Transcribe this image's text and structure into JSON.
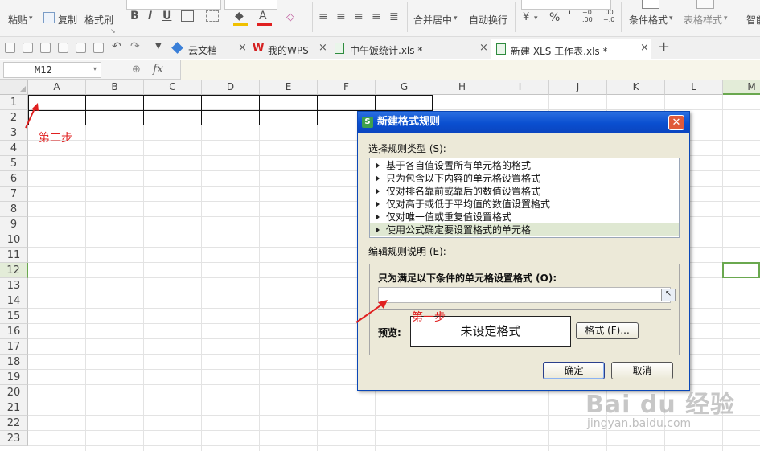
{
  "ribbon": {
    "paste_label": "粘贴",
    "copy_label": "复制",
    "format_painter_label": "格式刷",
    "bold": "B",
    "italic": "I",
    "underline": "U",
    "font_color": "A",
    "merge_center_label": "合并居中",
    "wrap_text_label": "自动换行",
    "percent": "%",
    "comma": "'",
    "decimal_increase": "+0\n.00",
    "decimal_decrease": ".00\n+.0",
    "conditional_format_label": "条件格式",
    "table_style_label": "表格样式",
    "smart_label": "智能"
  },
  "tabs": [
    {
      "label": "云文档",
      "icon": "cloud-icon",
      "active": false
    },
    {
      "label": "我的WPS",
      "icon": "wps-icon",
      "active": false
    },
    {
      "label": "中午饭统计.xls *",
      "icon": "sheet-icon",
      "active": false
    },
    {
      "label": "新建 XLS 工作表.xls *",
      "icon": "sheet-icon",
      "active": true
    }
  ],
  "tab_close": "×",
  "new_tab": "+",
  "formula_bar": {
    "cell_ref": "M12",
    "fx": "fx"
  },
  "columns": [
    "A",
    "B",
    "C",
    "D",
    "E",
    "F",
    "G",
    "H",
    "I",
    "J",
    "K",
    "L",
    "M"
  ],
  "rows": [
    "1",
    "2",
    "3",
    "4",
    "5",
    "6",
    "7",
    "8",
    "9",
    "10",
    "11",
    "12",
    "13",
    "14",
    "15",
    "16",
    "17",
    "18",
    "19",
    "20",
    "21",
    "22",
    "23"
  ],
  "selected_cell": "M12",
  "dialog": {
    "title": "新建格式规则",
    "close": "✕",
    "rule_type_label": "选择规则类型 (S):",
    "rule_types": [
      "基于各自值设置所有单元格的格式",
      "只为包含以下内容的单元格设置格式",
      "仅对排名靠前或靠后的数值设置格式",
      "仅对高于或低于平均值的数值设置格式",
      "仅对唯一值或重复值设置格式",
      "使用公式确定要设置格式的单元格"
    ],
    "selected_rule_index": 5,
    "edit_label": "编辑规则说明 (E):",
    "condition_label": "只为满足以下条件的单元格设置格式 (O):",
    "condition_value": "",
    "preview_label": "预览:",
    "preview_text": "未设定格式",
    "format_button": "格式 (F)...",
    "ok_button": "确定",
    "cancel_button": "取消"
  },
  "annotations": {
    "step_one": "第一步",
    "step_two": "第二步"
  },
  "watermark": {
    "brand": "Bai du 经验",
    "url": "jingyan.baidu.com"
  },
  "colors": {
    "dialog_title": "#0a4fd0",
    "annotation": "#e02020",
    "selected_cell_border": "#6aa84f",
    "selected_rule_bg": "#dfe8d2"
  }
}
